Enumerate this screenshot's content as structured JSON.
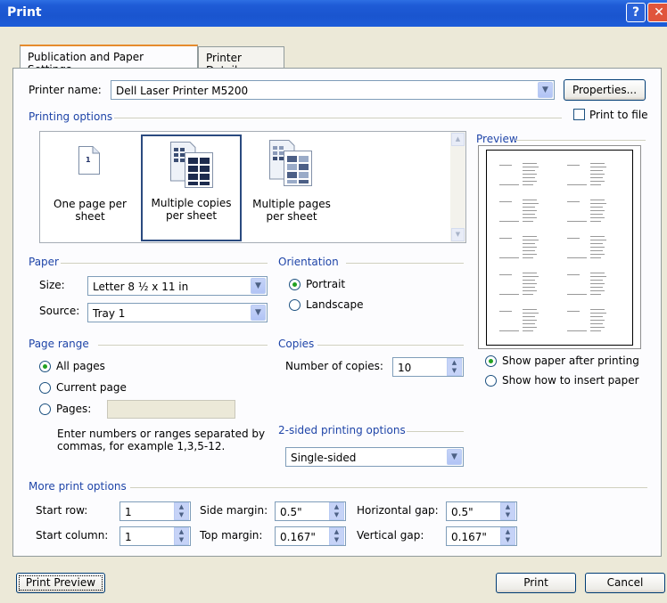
{
  "window": {
    "title": "Print",
    "help_glyph": "?",
    "close_glyph": "✕"
  },
  "tabs": [
    {
      "label": "Publication and Paper Settings"
    },
    {
      "label": "Printer Details"
    }
  ],
  "printer": {
    "name_label": "Printer name:",
    "name_value": "Dell Laser Printer M5200",
    "properties_label": "Properties...",
    "print_to_file_label": "Print to file"
  },
  "printing_options": {
    "group_label": "Printing options",
    "options": [
      {
        "label": "One page per sheet",
        "thumb_number": "1"
      },
      {
        "label": "Multiple copies per sheet"
      },
      {
        "label": "Multiple pages per sheet"
      }
    ],
    "selected": "Multiple copies per sheet"
  },
  "preview": {
    "label": "Preview"
  },
  "paper": {
    "group_label": "Paper",
    "size_label": "Size:",
    "size_value": "Letter 8 ½ x 11 in",
    "source_label": "Source:",
    "source_value": "Tray 1"
  },
  "orientation": {
    "group_label": "Orientation",
    "portrait_label": "Portrait",
    "landscape_label": "Landscape",
    "selected": "Portrait"
  },
  "page_range": {
    "group_label": "Page range",
    "all_label": "All pages",
    "current_label": "Current page",
    "pages_label": "Pages:",
    "pages_value": "",
    "hint_line1": "Enter numbers or ranges separated by",
    "hint_line2": "commas, for example 1,3,5-12.",
    "selected": "All pages"
  },
  "copies": {
    "group_label": "Copies",
    "number_label": "Number of copies:",
    "number_value": "10"
  },
  "sided": {
    "group_label": "2-sided printing options",
    "value": "Single-sided"
  },
  "after_printing": {
    "show_paper_label": "Show paper after printing",
    "show_insert_label": "Show how to insert paper",
    "selected": "Show paper after printing"
  },
  "more_options": {
    "group_label": "More print options",
    "start_row_label": "Start row:",
    "start_row_value": "1",
    "start_column_label": "Start column:",
    "start_column_value": "1",
    "side_margin_label": "Side margin:",
    "side_margin_value": "0.5\"",
    "top_margin_label": "Top margin:",
    "top_margin_value": "0.167\"",
    "horizontal_gap_label": "Horizontal gap:",
    "horizontal_gap_value": "0.5\"",
    "vertical_gap_label": "Vertical gap:",
    "vertical_gap_value": "0.167\""
  },
  "footer": {
    "print_preview_label": "Print Preview",
    "print_label": "Print",
    "cancel_label": "Cancel"
  },
  "colors": {
    "title_bar": "#1a55cf",
    "group_label": "#1f45a8",
    "dialog_bg": "#ece9d8",
    "radio_dot": "#21a121"
  }
}
